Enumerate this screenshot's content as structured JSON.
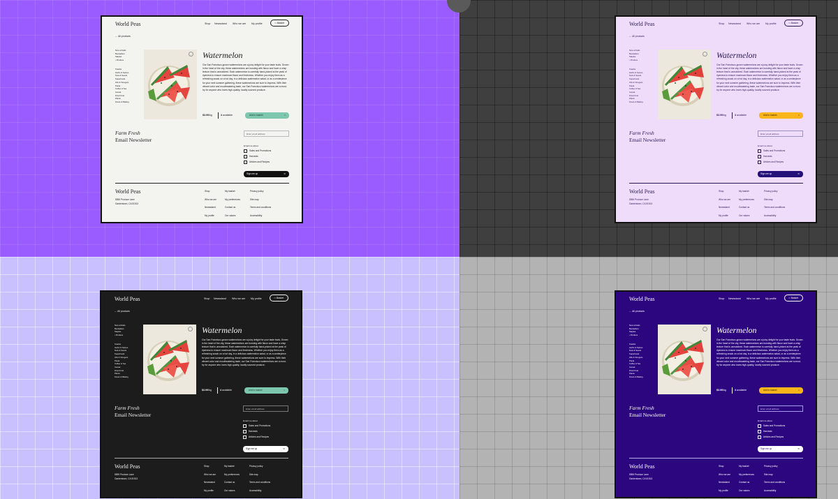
{
  "brand": "World Peas",
  "nav": [
    "Shop",
    "Newsstand",
    "Who we are",
    "My profile"
  ],
  "basket_label": "Basket",
  "back_link": "← All products",
  "categories_top": [
    "New arrivals",
    "Bestsellers",
    "Staples",
    "• Produce"
  ],
  "categories_bottom": [
    "Snacks",
    "Herbs & Spices",
    "Nuts & Seeds",
    "Superfoods",
    "Oils & Vinegars",
    "Pasta",
    "Coffee & Tea",
    "Cereal",
    "Dried Fruit",
    "Plants",
    "Flours & Baking"
  ],
  "product": {
    "title": "Watermelon",
    "description": "Our San Francisco-grown watermelons are a juicy delight for your taste buds. Grown in the heart of the city, these watermelons are bursting with flavor and have a crisp texture that is unmatched. Each watermelon is carefully hand-picked at the peak of ripeness to ensure maximum flavor and freshness. Whether you enjoy them as a refreshing snack on a hot day, in a delicious watermelon salad, or as a centerpiece for your next summer gathering, these watermelons are sure to impress. With their vibrant color and mouthwatering taste, our San Francisco watermelons are a must-try for anyone who loves high-quality, locally sourced produce.",
    "price": "$3.99",
    "price_unit": "/kg",
    "available_count": "4",
    "available_label": "available",
    "add_button": "Add to basket"
  },
  "newsletter": {
    "title_italic": "Farm Fresh",
    "title": "Email Newsletter",
    "email_placeholder": "Enter email address",
    "email_me_about": "Email me about",
    "options": [
      "Sales and Promotions",
      "Harvests",
      "Articles and Recipes"
    ],
    "signup_button": "Sign me up"
  },
  "footer": {
    "brand": "World Peas",
    "address_line1": "5555 Produce Lane",
    "address_line2": "Gardentown, CA 51513",
    "col1": [
      "Shop",
      "Who we are",
      "Newsstand",
      "My profile"
    ],
    "col2": [
      "My basket",
      "My preferences",
      "Contact us",
      "Our values"
    ],
    "col3": [
      "Privacy policy",
      "Site map",
      "Terms and conditions",
      "Accessibility"
    ]
  },
  "themes": {
    "light": {
      "bg": "#f3f3f0",
      "text": "#222222",
      "muted": "#555555",
      "accent": "#7cc7ae",
      "accent_text": "#1b3a30",
      "signup_bg": "#111111",
      "signup_text": "#ffffff",
      "line": "#222222",
      "input_border": "#bbbbbb"
    },
    "lavender": {
      "bg": "#efdcfb",
      "text": "#2a1a55",
      "muted": "#4d3d70",
      "accent": "#f9b51a",
      "accent_text": "#3a2400",
      "signup_bg": "#25107a",
      "signup_text": "#ffffff",
      "line": "#2a1a55",
      "input_border": "#9c8fc2"
    },
    "dark": {
      "bg": "#1c1c1c",
      "text": "#f0f0f0",
      "muted": "#cccccc",
      "accent": "#7cc7ae",
      "accent_text": "#1b3a30",
      "signup_bg": "#ffffff",
      "signup_text": "#111111",
      "line": "#aaaaaa",
      "input_border": "#777777"
    },
    "indigo": {
      "bg": "#2b067f",
      "text": "#ffffff",
      "muted": "#d9d0ff",
      "accent": "#f9b51a",
      "accent_text": "#3a2400",
      "signup_bg": "#ffffff",
      "signup_text": "#2b067f",
      "line": "#b9aef0",
      "input_border": "#a899f2"
    }
  }
}
